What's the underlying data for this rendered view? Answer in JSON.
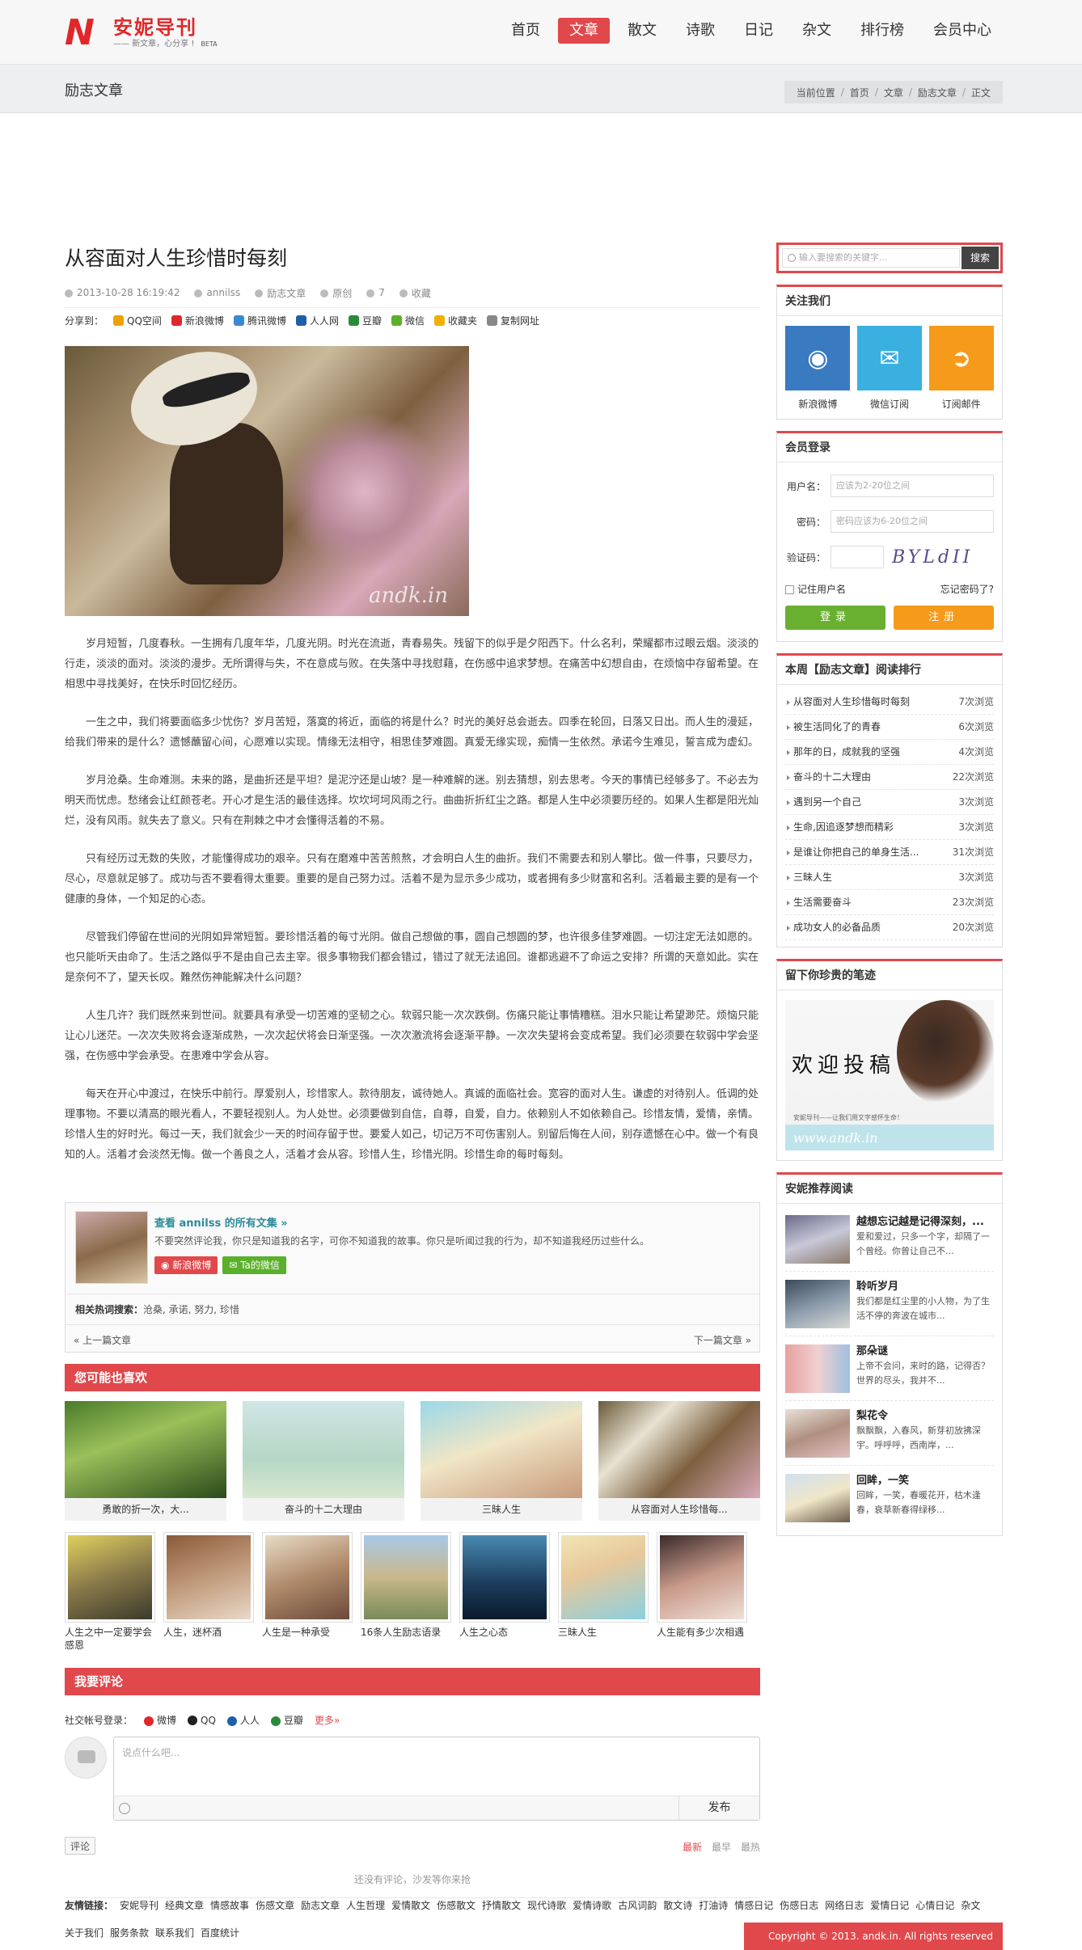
{
  "header": {
    "logo_title": "安妮导刊",
    "logo_slogan": "—— 新文章，心分享 !",
    "logo_beta": "BETA",
    "nav": [
      {
        "label": "首页"
      },
      {
        "label": "文章",
        "active": true
      },
      {
        "label": "散文"
      },
      {
        "label": "诗歌"
      },
      {
        "label": "日记"
      },
      {
        "label": "杂文"
      },
      {
        "label": "排行榜"
      },
      {
        "label": "会员中心"
      }
    ]
  },
  "crumbbar": {
    "section": "励志文章",
    "crumbs": [
      "当前位置",
      "首页",
      "文章",
      "励志文章",
      "正文"
    ]
  },
  "article": {
    "title": "从容面对人生珍惜时每刻",
    "date": "2013-10-28 16:19:42",
    "author": "annilss",
    "category": "励志文章",
    "source": "原创",
    "stars": "7",
    "fav": "收藏",
    "share_label": "分享到：",
    "share": [
      {
        "name": "QQ空间",
        "color": "#f0a000"
      },
      {
        "name": "新浪微博",
        "color": "#e0272a"
      },
      {
        "name": "腾讯微博",
        "color": "#3a8ad0"
      },
      {
        "name": "人人网",
        "color": "#1f5fa8"
      },
      {
        "name": "豆瓣",
        "color": "#2a8a3a"
      },
      {
        "name": "微信",
        "color": "#5ab02a"
      },
      {
        "name": "收藏夹",
        "color": "#f0b000"
      },
      {
        "name": "复制网址",
        "color": "#888888"
      }
    ],
    "image_watermark": "andk.in",
    "paragraphs": [
      "岁月短暂，几度春秋。一生拥有几度年华，几度光阴。时光在流逝，青春易失。残留下的似乎是夕阳西下。什么名利，荣耀都市过眼云烟。淡淡的行走，淡淡的面对。淡淡的漫步。无所谓得与失，不在意成与败。在失落中寻找慰藉，在伤感中追求梦想。在痛苦中幻想自由，在烦恼中存留希望。在相思中寻找美好，在快乐时回忆经历。",
      "一生之中，我们将要面临多少忧伤？岁月苦短，落寞的将近，面临的将是什么？时光的美好总会逝去。四季在轮回，日落又日出。而人生的漫延，给我们带来的是什么？遗憾蘸留心间，心愿难以实现。情缘无法相守，相思佳梦难圆。真爱无缘实现，痴情一生依然。承诺今生难见，誓言成为虚幻。",
      "岁月沧桑。生命难测。未来的路，是曲折还是平坦？是泥泞还是山坡？是一种难解的迷。别去猜想，别去思考。今天的事情已经够多了。不必去为明天而忧虑。愁绪会让红颜苍老。开心才是生活的最佳选择。坎坎坷坷风雨之行。曲曲折折红尘之路。都是人生中必须要历经的。如果人生都是阳光灿烂，没有风雨。就失去了意义。只有在荆棘之中才会懂得活着的不易。",
      "只有经历过无数的失败，才能懂得成功的艰辛。只有在磨难中苦苦煎熬，才会明白人生的曲折。我们不需要去和别人攀比。做一件事，只要尽力，尽心，尽意就足够了。成功与否不要看得太重要。重要的是自己努力过。活着不是为显示多少成功，或者拥有多少财富和名利。活着最主要的是有一个健康的身体，一个知足的心态。",
      "尽管我们停留在世间的光阴如异常短暂。要珍惜活着的每寸光阴。做自己想做的事，圆自己想圆的梦，也许很多佳梦难圆。一切注定无法如愿的。也只能听天由命了。生活之路似乎不是由自己去主宰。很多事物我们都会错过，错过了就无法追回。谁都逃避不了命运之安排？所谓的天意如此。实在是奈何不了，望天长叹。難然伤神能解决什么问题？",
      "人生几许？我们既然来到世间。就要具有承受一切苦难的坚韧之心。软弱只能一次次跌倒。伤痛只能让事情糟糕。泪水只能让希望渺茫。烦恼只能让心儿迷茫。一次次失败将会逐渐成熟，一次次起伏将会日渐坚强。一次次激流将会逐渐平静。一次次失望将会变成希望。我们必须要在软弱中学会坚强，在伤感中学会承受。在患难中学会从容。",
      "每天在开心中渡过，在快乐中前行。厚爱别人，珍惜家人。款待朋友，诚待她人。真诚的面临社会。宽容的面对人生。谦虚的对待别人。低调的处理事物。不要以清高的眼光看人，不要轻视别人。为人处世。必须要做到自信，自尊，自爱，自力。依赖别人不如依赖自己。珍惜友情，爱情，亲情。珍惜人生的好时光。每过一天，我们就会少一天的时间存留于世。要爱人如己，切记万不可伤害别人。别留后悔在人间，别存遗憾在心中。做一个有良知的人。活着才会淡然无悔。做一个善良之人，活着才会从容。珍惜人生，珍惜光阴。珍惜生命的每时每刻。"
    ]
  },
  "author_box": {
    "link": "查看 annilss 的所有文集 »",
    "desc": "不要突然评论我，你只是知道我的名字，可你不知道我的故事。你只是听闻过我的行为，却不知道我经历过些什么。",
    "weibo_btn": "新浪微博",
    "wechat_btn": "Ta的微信",
    "tags_label": "相关热词搜索：",
    "tags": "沧桑, 承诺, 努力, 珍惜",
    "prev": "« 上一篇文章",
    "next": "下一篇文章 »"
  },
  "likes": {
    "title": "您可能也喜欢",
    "cards": [
      {
        "cap": "勇敢的折一次，大...",
        "bg": "linear-gradient(160deg,#4a7a2a 0%,#9ac05a 40%,#2a4a1a 100%)"
      },
      {
        "cap": "奋斗的十二大理由",
        "bg": "linear-gradient(180deg,#cfe6e6 0%,#b6d6c6 60%,#d8e8d0 100%)"
      },
      {
        "cap": "三昧人生",
        "bg": "linear-gradient(160deg,#9ad8e8 0%,#f0e6c6 45%,#c89a7a 100%)"
      },
      {
        "cap": "从容面对人生珍惜每...",
        "bg": "linear-gradient(135deg,#6a5a3a 0%,#e8e2d2 30%,#7d6040 60%,#d8a8b8 100%)"
      }
    ],
    "thumbs": [
      {
        "cap": "人生之中一定要学会感恩",
        "bg": "linear-gradient(160deg,#e0d060 0%,#8a7a4a 50%,#3a3a2a 100%)"
      },
      {
        "cap": "人生，迷杯酒",
        "bg": "linear-gradient(160deg,#8a5a3a 0%,#c09a7a 50%,#e8d8c8 100%)"
      },
      {
        "cap": "人生是一种承受",
        "bg": "linear-gradient(160deg,#e8dcc8 0%,#b08a6a 50%,#6a4a3a 100%)"
      },
      {
        "cap": "16条人生励志语录",
        "bg": "linear-gradient(180deg,#a8c8e8 0%,#c8b88a 50%,#7a8a5a 100%)"
      },
      {
        "cap": "人生之心态",
        "bg": "linear-gradient(180deg,#4a8ab0 0%,#1a3a5a 60%,#0a1a2a 100%)"
      },
      {
        "cap": "三昧人生",
        "bg": "linear-gradient(160deg,#f0e6b6 0%,#e8c89a 40%,#8ad0e0 100%)"
      },
      {
        "cap": "人生能有多少次相遇",
        "bg": "linear-gradient(160deg,#3a2a2a 0%,#c89a8a 50%,#f0e0d8 100%)"
      }
    ]
  },
  "comments": {
    "title": "我要评论",
    "social_label": "社交帐号登录：",
    "social": [
      {
        "name": "微博",
        "color": "#e0272a"
      },
      {
        "name": "QQ",
        "color": "#222222"
      },
      {
        "name": "人人",
        "color": "#1f5fa8"
      },
      {
        "name": "豆瓣",
        "color": "#2a8a3a"
      }
    ],
    "more": "更多»",
    "placeholder": "说点什么吧...",
    "send": "发布",
    "comment_btn": "评论",
    "sort": [
      "最新",
      "最早",
      "最热"
    ],
    "empty": "还没有评论，沙发等你来抢"
  },
  "sidebar": {
    "search_placeholder": "输入要搜索的关键字...",
    "search_btn": "搜索",
    "follow_title": "关注我们",
    "follow": [
      {
        "label": "新浪微博",
        "color": "#3a7ac0",
        "icon": "weibo-icon",
        "glyph": "◉"
      },
      {
        "label": "微信订阅",
        "color": "#3ab0e0",
        "icon": "wechat-icon",
        "glyph": "✉"
      },
      {
        "label": "订阅邮件",
        "color": "#f59a1a",
        "icon": "rss-icon",
        "glyph": "➲"
      }
    ],
    "login_title": "会员登录",
    "user_label": "用户名：",
    "user_ph": "应该为2-20位之间",
    "pass_label": "密码：",
    "pass_ph": "密码应该为6-20位之间",
    "code_label": "验证码：",
    "captcha": "BYLdII",
    "remember": "记住用户名",
    "forgot": "忘记密码了?",
    "login_btn": "登录",
    "reg_btn": "注册",
    "rank_title": "本周【励志文章】阅读排行",
    "rank": [
      {
        "t": "从容面对人生珍惜每时每刻",
        "c": "7次浏览"
      },
      {
        "t": "被生活同化了的青春",
        "c": "6次浏览"
      },
      {
        "t": "那年的日，成就我的坚强",
        "c": "4次浏览"
      },
      {
        "t": "奋斗的十二大理由",
        "c": "22次浏览"
      },
      {
        "t": "遇到另一个自己",
        "c": "3次浏览"
      },
      {
        "t": "生命,因追逐梦想而精彩",
        "c": "3次浏览"
      },
      {
        "t": "是谁让你把自己的单身生活...",
        "c": "31次浏览"
      },
      {
        "t": "三昧人生",
        "c": "3次浏览"
      },
      {
        "t": "生活需要奋斗",
        "c": "23次浏览"
      },
      {
        "t": "成功女人的必备品质",
        "c": "20次浏览"
      }
    ],
    "promo_title": "留下你珍贵的笔迹",
    "promo_text": "欢迎投稿",
    "promo_sub": "安妮导刊——让我们用文字感怀生命！",
    "promo_url": "www.andk.in",
    "rec_title": "安妮推荐阅读",
    "rec": [
      {
        "h": "越想忘记越是记得深刻，...",
        "d": "爱和爱过，只多一个字，却隔了一个曾经。你曾让自己不...",
        "bg": "linear-gradient(160deg,#6a6a8a 0%,#c8c8d8 50%,#8a7a6a 100%)"
      },
      {
        "h": "聆听岁月",
        "d": "我们都是红尘里的小人物，为了生活不停的奔波在城市...",
        "bg": "linear-gradient(160deg,#3a4a5a 0%,#8a9aaa 50%,#d8d8d8 100%)"
      },
      {
        "h": "那朵谜",
        "d": "上帝不会问，来时的路，记得否？世界的尽头，我并不...",
        "bg": "linear-gradient(90deg,#e8a0a0 0%,#f0d0d0 50%,#a0c0e0 100%)"
      },
      {
        "h": "梨花令",
        "d": "飘飘飘，入春风，新芽初放拂深宇。呼呼呼，西南岸，...",
        "bg": "linear-gradient(160deg,#e8e0d8 0%,#b09080 50%,#e0c0c0 100%)"
      },
      {
        "h": "回眸，一笑",
        "d": "回眸，一笑，春暖花开，枯木逢春，衰草新春得绿移...",
        "bg": "linear-gradient(160deg,#d0e0f0 0%,#f0e6c8 50%,#6a5a4a 100%)"
      }
    ]
  },
  "footer": {
    "friends_label": "友情链接：",
    "friends": [
      "安妮导刊",
      "经典文章",
      "情感故事",
      "伤感文章",
      "励志文章",
      "人生哲理",
      "爱情散文",
      "伤感散文",
      "抒情散文",
      "现代诗歌",
      "爱情诗歌",
      "古风词韵",
      "散文诗",
      "打油诗",
      "情感日记",
      "伤感日志",
      "网络日志",
      "爱情日记",
      "心情日记",
      "杂文"
    ],
    "links": [
      "关于我们",
      "服务条款",
      "联系我们",
      "百度统计"
    ],
    "copyright": "Copyright © 2013. andk.in. All rights reserved"
  }
}
